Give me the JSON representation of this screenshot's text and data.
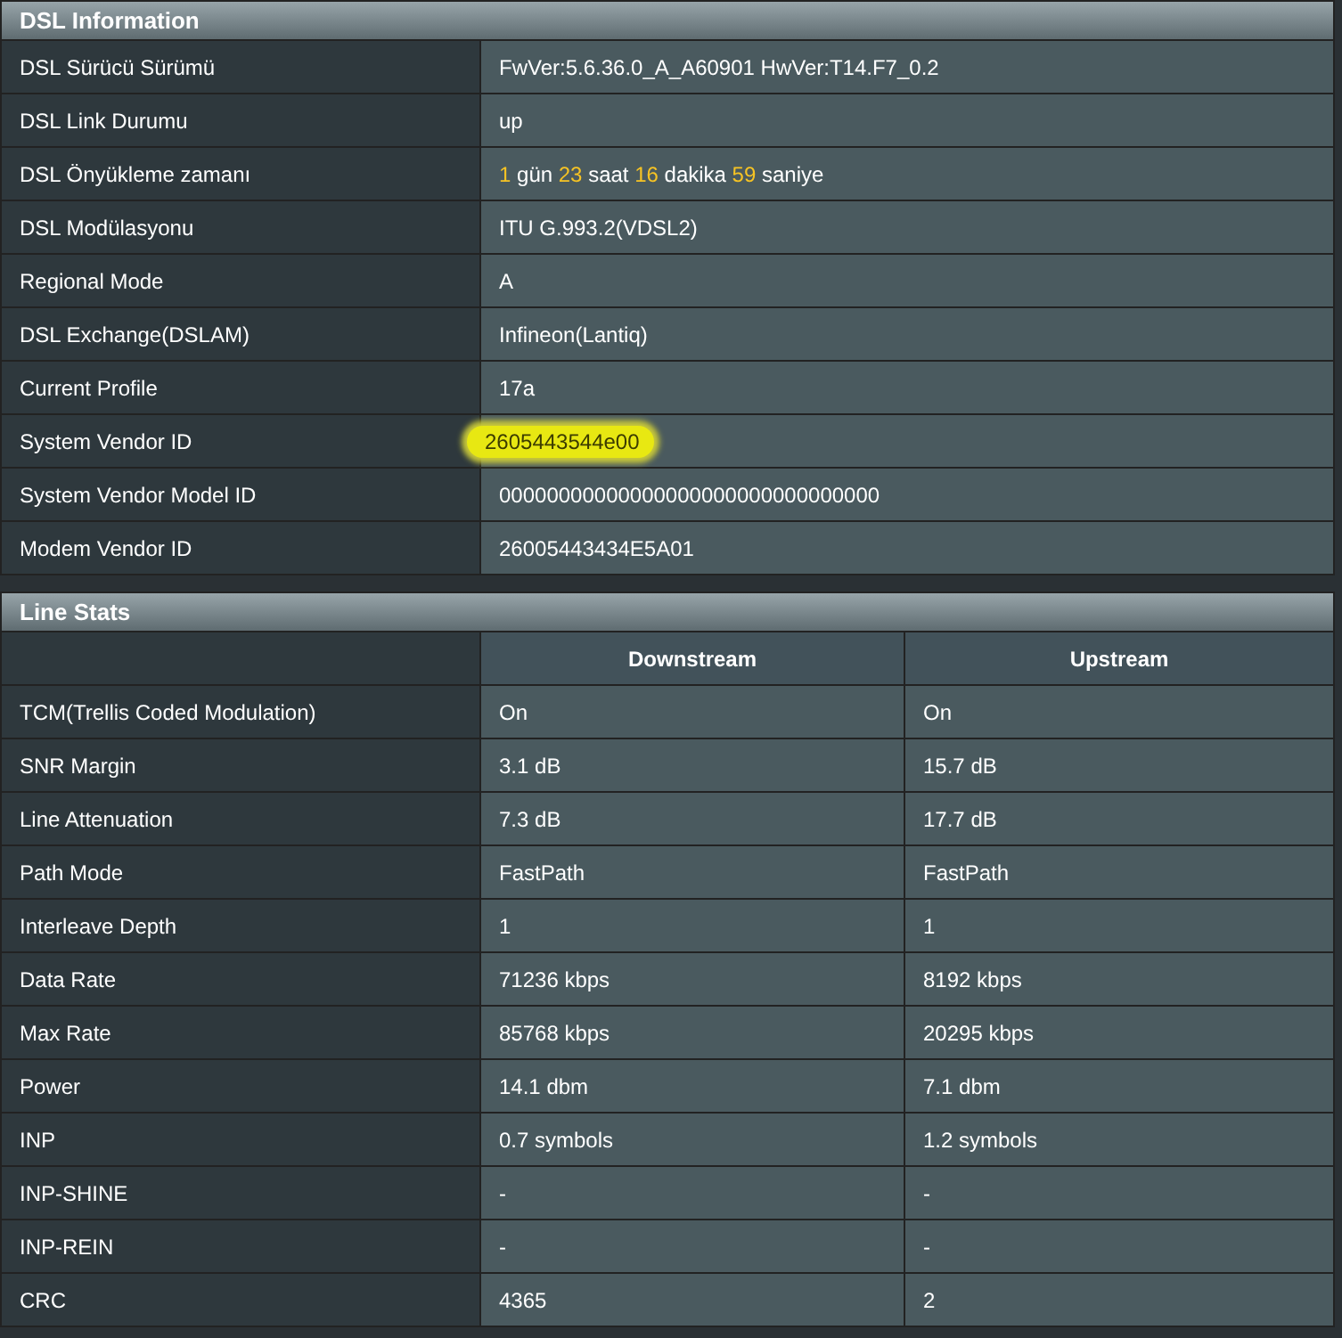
{
  "dsl_information": {
    "title": "DSL Information",
    "rows": [
      {
        "label": "DSL Sürücü Sürümü",
        "value": "FwVer:5.6.36.0_A_A60901 HwVer:T14.F7_0.2"
      },
      {
        "label": "DSL Link Durumu",
        "value": "up"
      },
      {
        "label": "DSL Önyükleme zamanı",
        "value_parts": [
          {
            "kind": "number",
            "text": "1"
          },
          {
            "kind": "unit",
            "text": "gün"
          },
          {
            "kind": "number",
            "text": "23"
          },
          {
            "kind": "unit",
            "text": "saat"
          },
          {
            "kind": "number",
            "text": "16"
          },
          {
            "kind": "unit",
            "text": "dakika"
          },
          {
            "kind": "number",
            "text": "59"
          },
          {
            "kind": "unit",
            "text": "saniye"
          }
        ]
      },
      {
        "label": "DSL Modülasyonu",
        "value": "ITU G.993.2(VDSL2)"
      },
      {
        "label": "Regional Mode",
        "value": "A"
      },
      {
        "label": "DSL Exchange(DSLAM)",
        "value": "Infineon(Lantiq)"
      },
      {
        "label": "Current Profile",
        "value": "17a"
      },
      {
        "label": "System Vendor ID",
        "value": "2605443544e00",
        "highlighted": true
      },
      {
        "label": "System Vendor Model ID",
        "value": "00000000000000000000000000000000"
      },
      {
        "label": "Modem Vendor ID",
        "value": "26005443434E5A01"
      }
    ]
  },
  "line_stats": {
    "title": "Line Stats",
    "columns": [
      "Downstream",
      "Upstream"
    ],
    "rows": [
      {
        "label": "TCM(Trellis Coded Modulation)",
        "downstream": "On",
        "upstream": "On"
      },
      {
        "label": "SNR Margin",
        "downstream": "3.1 dB",
        "upstream": "15.7 dB"
      },
      {
        "label": "Line Attenuation",
        "downstream": "7.3 dB",
        "upstream": "17.7 dB"
      },
      {
        "label": "Path Mode",
        "downstream": "FastPath",
        "upstream": "FastPath"
      },
      {
        "label": "Interleave Depth",
        "downstream": "1",
        "upstream": "1"
      },
      {
        "label": "Data Rate",
        "downstream": "71236 kbps",
        "upstream": "8192 kbps"
      },
      {
        "label": "Max Rate",
        "downstream": "85768 kbps",
        "upstream": "20295 kbps"
      },
      {
        "label": "Power",
        "downstream": "14.1 dbm",
        "upstream": "7.1 dbm"
      },
      {
        "label": "INP",
        "downstream": "0.7 symbols",
        "upstream": "1.2 symbols"
      },
      {
        "label": "INP-SHINE",
        "downstream": "-",
        "upstream": "-"
      },
      {
        "label": "INP-REIN",
        "downstream": "-",
        "upstream": "-"
      },
      {
        "label": "CRC",
        "downstream": "4365",
        "upstream": "2"
      }
    ]
  }
}
